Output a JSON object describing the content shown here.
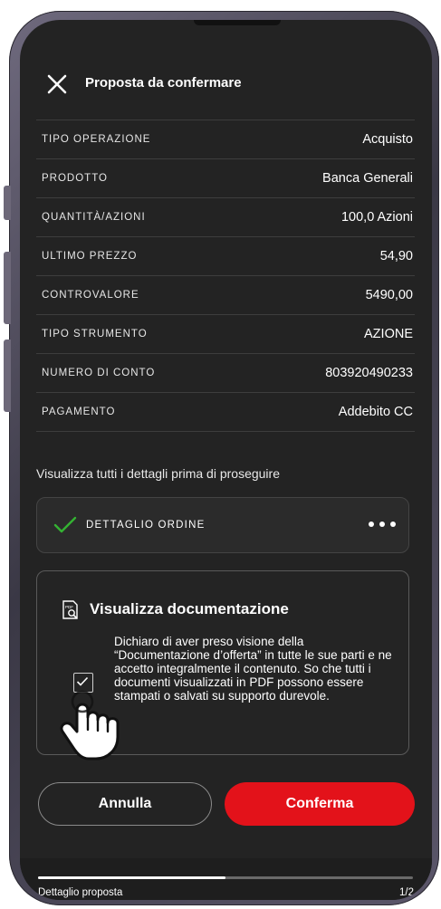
{
  "header": {
    "title": "Proposta da confermare"
  },
  "rows": [
    {
      "label": "TIPO OPERAZIONE",
      "value": "Acquisto"
    },
    {
      "label": "PRODOTTO",
      "value": "Banca Generali"
    },
    {
      "label": "QUANTITÀ/AZIONI",
      "value": "100,0 Azioni"
    },
    {
      "label": "ULTIMO PREZZO",
      "value": "54,90"
    },
    {
      "label": "CONTROVALORE",
      "value": "5490,00"
    },
    {
      "label": "TIPO STRUMENTO",
      "value": "AZIONE"
    },
    {
      "label": "NUMERO DI CONTO",
      "value": "803920490233"
    },
    {
      "label": "PAGAMENTO",
      "value": "Addebito CC"
    }
  ],
  "hint": "Visualizza tutti i dettagli prima di proseguire",
  "detail_card": {
    "label": "DETTAGLIO ORDINE",
    "checked": true
  },
  "documentation": {
    "title": "Visualizza documentazione",
    "text": "Dichiaro di aver preso visione della “Documentazione d’offerta” in tutte le sue parti e ne accetto integralmente il contenuto. So che tutti i documenti visualizzati in PDF possono essere stampati o salvati su supporto durevole.",
    "checked": true
  },
  "buttons": {
    "cancel": "Annulla",
    "confirm": "Conferma"
  },
  "footer": {
    "label": "Dettaglio proposta",
    "page": "1/2",
    "progress": 0.5
  },
  "colors": {
    "accent": "#e3121a",
    "check_green": "#34b233",
    "background": "#232323"
  }
}
